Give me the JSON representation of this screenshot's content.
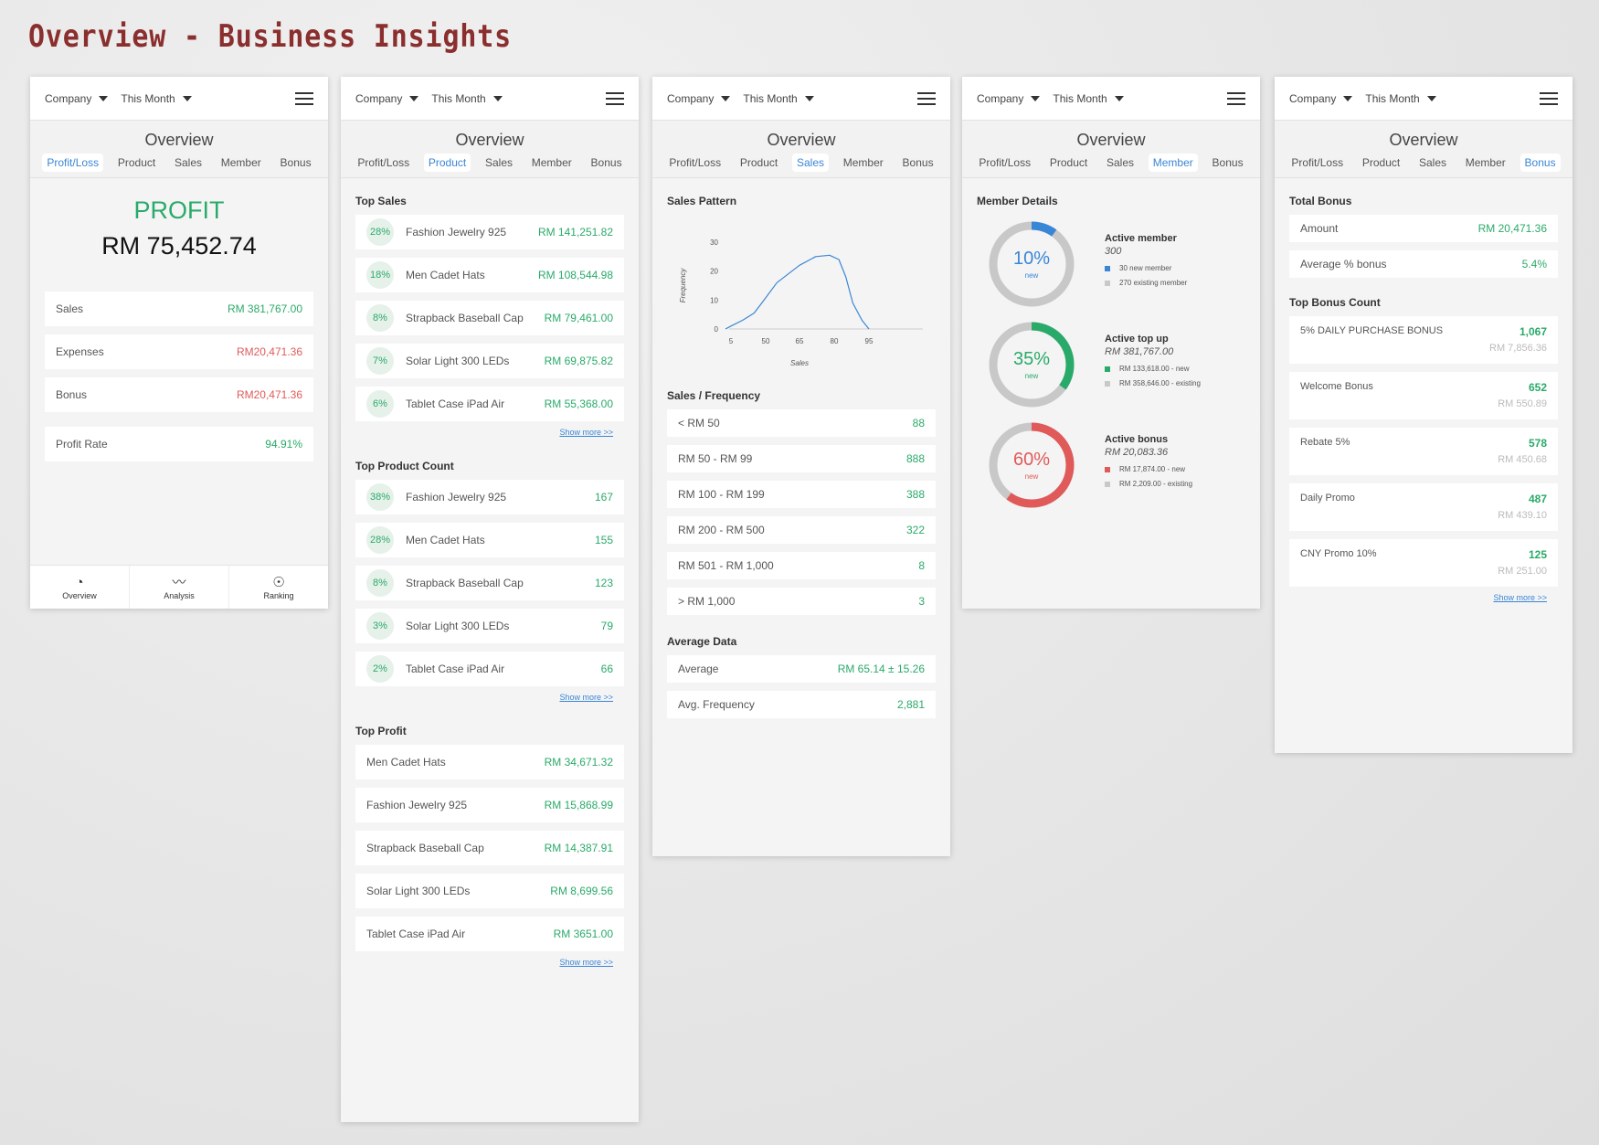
{
  "page_title": "Overview - Business Insights",
  "common": {
    "company": "Company",
    "period": "This Month",
    "overview": "Overview",
    "tabs": [
      "Profit/Loss",
      "Product",
      "Sales",
      "Member",
      "Bonus"
    ]
  },
  "colors": {
    "green": "#2aaa6a",
    "red": "#e05a5a",
    "blue": "#3a86d6",
    "grey": "#c8c8c8"
  },
  "profit_panel": {
    "label": "PROFIT",
    "amount": "RM 75,452.74",
    "rows": [
      {
        "label": "Sales",
        "value": "RM 381,767.00"
      },
      {
        "label": "Expenses",
        "value": "RM20,471.36"
      },
      {
        "label": "Bonus",
        "value": "RM20,471.36"
      }
    ],
    "profit_rate": {
      "label": "Profit Rate",
      "value": "94.91%"
    },
    "nav": [
      {
        "label": "Overview",
        "icon": "pie-chart-icon"
      },
      {
        "label": "Analysis",
        "icon": "wave-chart-icon"
      },
      {
        "label": "Ranking",
        "icon": "medal-icon"
      }
    ]
  },
  "product_panel": {
    "show_more": "Show more >>",
    "top_sales": {
      "title": "Top Sales",
      "items": [
        {
          "pct": "28%",
          "name": "Fashion Jewelry 925",
          "value": "RM 141,251.82"
        },
        {
          "pct": "18%",
          "name": "Men Cadet Hats",
          "value": "RM 108,544.98"
        },
        {
          "pct": "8%",
          "name": "Strapback Baseball Cap",
          "value": "RM 79,461.00"
        },
        {
          "pct": "7%",
          "name": "Solar Light 300 LEDs",
          "value": "RM 69,875.82"
        },
        {
          "pct": "6%",
          "name": "Tablet Case iPad Air",
          "value": "RM 55,368.00"
        }
      ]
    },
    "top_count": {
      "title": "Top Product Count",
      "items": [
        {
          "pct": "38%",
          "name": "Fashion Jewelry 925",
          "value": "167"
        },
        {
          "pct": "28%",
          "name": "Men Cadet Hats",
          "value": "155"
        },
        {
          "pct": "8%",
          "name": "Strapback Baseball Cap",
          "value": "123"
        },
        {
          "pct": "3%",
          "name": "Solar Light 300 LEDs",
          "value": "79"
        },
        {
          "pct": "2%",
          "name": "Tablet Case iPad Air",
          "value": "66"
        }
      ]
    },
    "top_profit": {
      "title": "Top Profit",
      "items": [
        {
          "name": "Men Cadet Hats",
          "value": "RM 34,671.32"
        },
        {
          "name": "Fashion Jewelry 925",
          "value": "RM 15,868.99"
        },
        {
          "name": "Strapback Baseball Cap",
          "value": "RM 14,387.91"
        },
        {
          "name": "Solar Light 300 LEDs",
          "value": "RM 8,699.56"
        },
        {
          "name": "Tablet Case iPad Air",
          "value": "RM 3651.00"
        }
      ]
    }
  },
  "sales_panel": {
    "pattern_title": "Sales Pattern",
    "freq_title": "Sales / Frequency",
    "freq": [
      {
        "label": "< RM 50",
        "value": "88"
      },
      {
        "label": "RM 50 - RM 99",
        "value": "888"
      },
      {
        "label": "RM 100 - RM 199",
        "value": "388"
      },
      {
        "label": "RM 200 - RM 500",
        "value": "322"
      },
      {
        "label": "RM 501 - RM 1,000",
        "value": "8"
      },
      {
        "label": "> RM 1,000",
        "value": "3"
      }
    ],
    "avg_title": "Average Data",
    "avg": [
      {
        "label": "Average",
        "value": "RM 65.14 ± 15.26"
      },
      {
        "label": "Avg. Frequency",
        "value": "2,881"
      }
    ]
  },
  "chart_data": {
    "type": "line",
    "xlabel": "Sales",
    "ylabel": "Frequency",
    "x_ticks": [
      "5",
      "50",
      "65",
      "80",
      "95"
    ],
    "y_ticks": [
      "0",
      "10",
      "20",
      "30"
    ],
    "ylim": [
      0,
      30
    ],
    "x": [
      0,
      5,
      20,
      35,
      45,
      55,
      65,
      72,
      78,
      82,
      85,
      88,
      92,
      95
    ],
    "y": [
      0,
      1,
      3,
      5.5,
      9,
      16,
      22,
      25,
      25.5,
      24,
      18,
      9,
      3,
      0
    ],
    "grid": false
  },
  "member_panel": {
    "title": "Member Details",
    "new_label": "new",
    "blocks": [
      {
        "percent": 10,
        "pct_label": "10%",
        "color": "#3a86d6",
        "title": "Active member",
        "subtitle": "300",
        "legend": [
          "30 new member",
          "270 existing member"
        ]
      },
      {
        "percent": 35,
        "pct_label": "35%",
        "color": "#2aaa6a",
        "title": "Active top up",
        "subtitle": "RM 381,767.00",
        "legend": [
          "RM 133,618.00 - new",
          "RM 358,646.00 - existing"
        ]
      },
      {
        "percent": 60,
        "pct_label": "60%",
        "color": "#e05a5a",
        "title": "Active bonus",
        "subtitle": "RM 20,083.36",
        "legend": [
          "RM 17,874.00 - new",
          "RM 2,209.00 - existing"
        ]
      }
    ]
  },
  "bonus_panel": {
    "total_title": "Total Bonus",
    "total": [
      {
        "label": "Amount",
        "value": "RM 20,471.36"
      },
      {
        "label": "Average % bonus",
        "value": "5.4%"
      }
    ],
    "count_title": "Top Bonus Count",
    "items": [
      {
        "name": "5% DAILY PURCHASE BONUS",
        "count": "1,067",
        "amount": "RM 7,856.36"
      },
      {
        "name": "Welcome Bonus",
        "count": "652",
        "amount": "RM 550.89"
      },
      {
        "name": "Rebate 5%",
        "count": "578",
        "amount": "RM 450.68"
      },
      {
        "name": "Daily Promo",
        "count": "487",
        "amount": "RM 439.10"
      },
      {
        "name": "CNY Promo 10%",
        "count": "125",
        "amount": "RM 251.00"
      }
    ],
    "show_more": "Show more >>"
  }
}
